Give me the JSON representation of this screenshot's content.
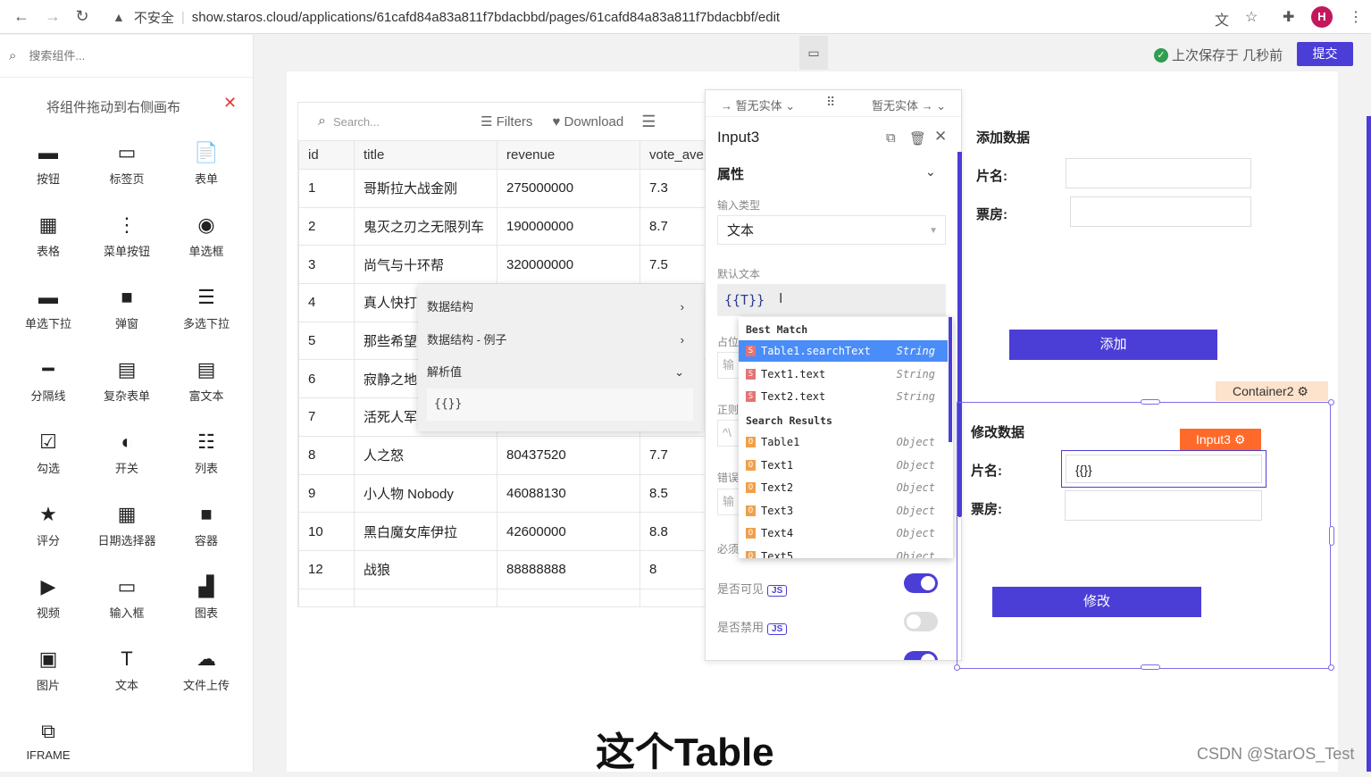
{
  "browser": {
    "security": "不安全",
    "url": "show.staros.cloud/applications/61cafd84a83a811f7bdacbbd/pages/61cafd84a83a811f7bdacbbf/edit",
    "avatar": "H"
  },
  "sidebar": {
    "search_placeholder": "搜索组件...",
    "hint": "将组件拖动到右侧画布",
    "components": [
      {
        "label": "按钮",
        "icon": "submit-button-icon",
        "glyph": "▬"
      },
      {
        "label": "标签页",
        "icon": "tabs-icon",
        "glyph": "▭"
      },
      {
        "label": "表单",
        "icon": "form-icon",
        "glyph": "📄"
      },
      {
        "label": "表格",
        "icon": "table-icon",
        "glyph": "▦"
      },
      {
        "label": "菜单按钮",
        "icon": "menu-button-icon",
        "glyph": "⋮"
      },
      {
        "label": "单选框",
        "icon": "radio-icon",
        "glyph": "◉"
      },
      {
        "label": "单选下拉",
        "icon": "select-icon",
        "glyph": "▬"
      },
      {
        "label": "弹窗",
        "icon": "modal-icon",
        "glyph": "■"
      },
      {
        "label": "多选下拉",
        "icon": "multiselect-icon",
        "glyph": "☰"
      },
      {
        "label": "分隔线",
        "icon": "divider-icon",
        "glyph": "━"
      },
      {
        "label": "复杂表单",
        "icon": "complex-form-icon",
        "glyph": "▤"
      },
      {
        "label": "富文本",
        "icon": "richtext-icon",
        "glyph": "▤"
      },
      {
        "label": "勾选",
        "icon": "checkbox-icon",
        "glyph": "☑"
      },
      {
        "label": "开关",
        "icon": "switch-icon",
        "glyph": "◐"
      },
      {
        "label": "列表",
        "icon": "list-icon",
        "glyph": "☷"
      },
      {
        "label": "评分",
        "icon": "rating-icon",
        "glyph": "★"
      },
      {
        "label": "日期选择器",
        "icon": "datepicker-icon",
        "glyph": "▦"
      },
      {
        "label": "容器",
        "icon": "container-icon",
        "glyph": "■"
      },
      {
        "label": "视频",
        "icon": "video-icon",
        "glyph": "▶"
      },
      {
        "label": "输入框",
        "icon": "input-icon",
        "glyph": "▭"
      },
      {
        "label": "图表",
        "icon": "chart-icon",
        "glyph": "▟"
      },
      {
        "label": "图片",
        "icon": "image-icon",
        "glyph": "▣"
      },
      {
        "label": "文本",
        "icon": "text-icon",
        "glyph": "T"
      },
      {
        "label": "文件上传",
        "icon": "upload-icon",
        "glyph": "☁"
      },
      {
        "label": "IFRAME",
        "icon": "iframe-icon",
        "glyph": "⧉"
      }
    ]
  },
  "header": {
    "saved_text": "上次保存于 几秒前",
    "submit_label": "提交"
  },
  "table": {
    "search_placeholder": "Search...",
    "filters_label": "Filters",
    "download_label": "Download",
    "columns": [
      "id",
      "title",
      "revenue",
      "vote_ave"
    ],
    "rows": [
      [
        "1",
        "哥斯拉大战金刚",
        "275000000",
        "7.3"
      ],
      [
        "2",
        "鬼灭之刃之无限列车",
        "190000000",
        "8.7"
      ],
      [
        "3",
        "尚气与十环帮",
        "320000000",
        "7.5"
      ],
      [
        "4",
        "真人快打",
        "",
        ""
      ],
      [
        "5",
        "那些希望",
        "",
        ""
      ],
      [
        "6",
        "寂静之地",
        "",
        ""
      ],
      [
        "7",
        "活死人军",
        "",
        ""
      ],
      [
        "8",
        "人之怒",
        "80437520",
        "7.7"
      ],
      [
        "9",
        "小人物 Nobody",
        "46088130",
        "8.5"
      ],
      [
        "10",
        "黑白魔女库伊拉",
        "42600000",
        "8.8"
      ],
      [
        "12",
        "战狼",
        "88888888",
        "8"
      ]
    ]
  },
  "context_menu": {
    "items": [
      "数据结构",
      "数据结构 - 例子",
      "解析值"
    ],
    "parsed_value": "{{}}"
  },
  "props": {
    "entity_left": "→ 暂无实体",
    "entity_right": "暂无实体 →",
    "component_name": "Input3",
    "section": "属性",
    "input_type_label": "输入类型",
    "input_type_value": "文本",
    "default_text_label": "默认文本",
    "default_text_value": "{{T}}",
    "placeholder_label": "占位",
    "placeholder_ghost": "输",
    "regex_label": "正则",
    "regex_ghost": "^\\",
    "error_label": "错误",
    "error_ghost": "输",
    "required_label": "必须",
    "visible_label": "是否可见",
    "disabled_label": "是否禁用",
    "js_label": "JS",
    "visible_on": true,
    "disabled_on": false
  },
  "autocomplete": {
    "best_match_label": "Best Match",
    "search_results_label": "Search Results",
    "best": [
      {
        "badge": "S",
        "name": "Table1.searchText",
        "type": "String"
      },
      {
        "badge": "S",
        "name": "Text1.text",
        "type": "String"
      },
      {
        "badge": "S",
        "name": "Text2.text",
        "type": "String"
      }
    ],
    "results": [
      {
        "badge": "O",
        "name": "Table1",
        "type": "Object"
      },
      {
        "badge": "O",
        "name": "Text1",
        "type": "Object"
      },
      {
        "badge": "O",
        "name": "Text2",
        "type": "Object"
      },
      {
        "badge": "O",
        "name": "Text3",
        "type": "Object"
      },
      {
        "badge": "O",
        "name": "Text4",
        "type": "Object"
      },
      {
        "badge": "O",
        "name": "Text5",
        "type": "Object"
      }
    ]
  },
  "add_form": {
    "title": "添加数据",
    "name_label": "片名:",
    "revenue_label": "票房:",
    "button": "添加"
  },
  "edit_form": {
    "container_tag": "Container2",
    "input_tag": "Input3",
    "title": "修改数据",
    "name_label": "片名:",
    "name_value": "{{}}",
    "revenue_label": "票房:",
    "button": "修改"
  },
  "caption": "这个Table",
  "watermark": "CSDN @StarOS_Test",
  "colors": {
    "accent": "#4b3ed6",
    "string_badge": "#e57373",
    "object_badge": "#f0a04b",
    "input_tag": "#ff6a2a",
    "container_tag": "#fde2cc"
  }
}
